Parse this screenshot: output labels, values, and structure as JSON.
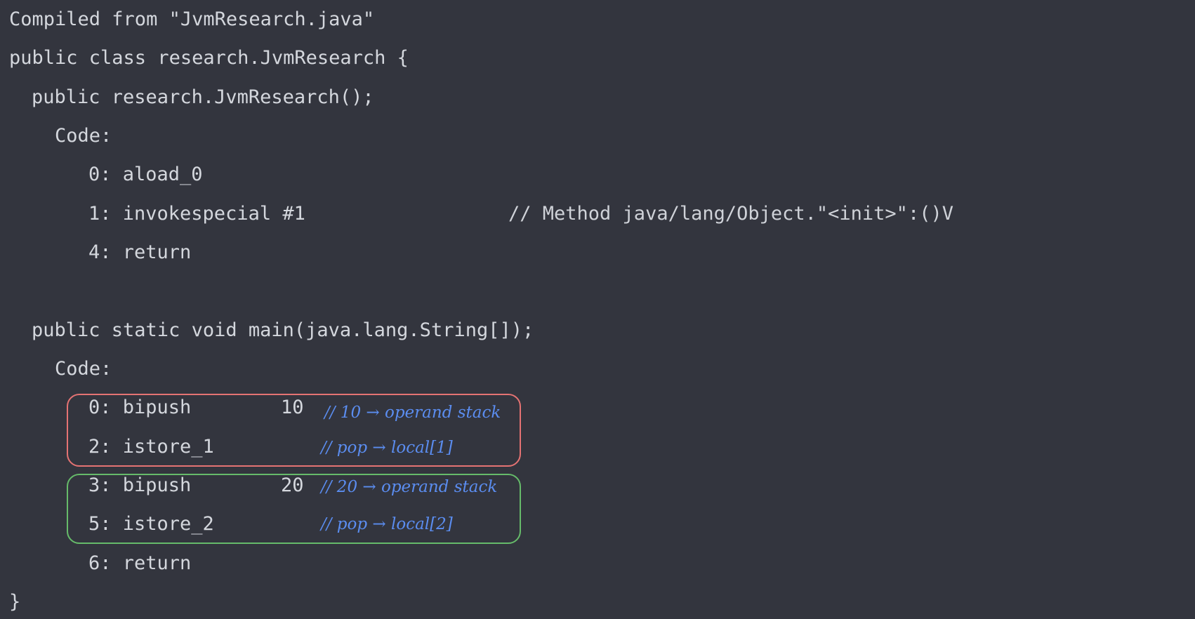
{
  "colors": {
    "background": "#33353e",
    "text": "#d4d7dd",
    "annotation": "#5b8df0",
    "box_red": "#e57373",
    "box_green": "#66bb6a"
  },
  "code": {
    "compiled_from": "Compiled from \"JvmResearch.java\"",
    "class_decl": "public class research.JvmResearch {",
    "ctor_decl": "public research.JvmResearch();",
    "ctor_code_label": "Code:",
    "ctor_instr_0": "0: aload_0",
    "ctor_instr_1": "1: invokespecial #1",
    "ctor_instr_1_comment": "// Method java/lang/Object.\"<init>\":()V",
    "ctor_instr_4": "4: return",
    "main_decl": "public static void main(java.lang.String[]);",
    "main_code_label": "Code:",
    "main_instr_0": "0: bipush",
    "main_instr_0_arg": "10",
    "main_instr_2": "2: istore_1",
    "main_instr_3": "3: bipush",
    "main_instr_3_arg": "20",
    "main_instr_5": "5: istore_2",
    "main_instr_6": "6: return",
    "class_close": "}"
  },
  "annotations": {
    "a1": "// 10 → operand stack",
    "a2": "// pop → local[1]",
    "a3": "// 20 → operand stack",
    "a4": "// pop → local[2]"
  }
}
